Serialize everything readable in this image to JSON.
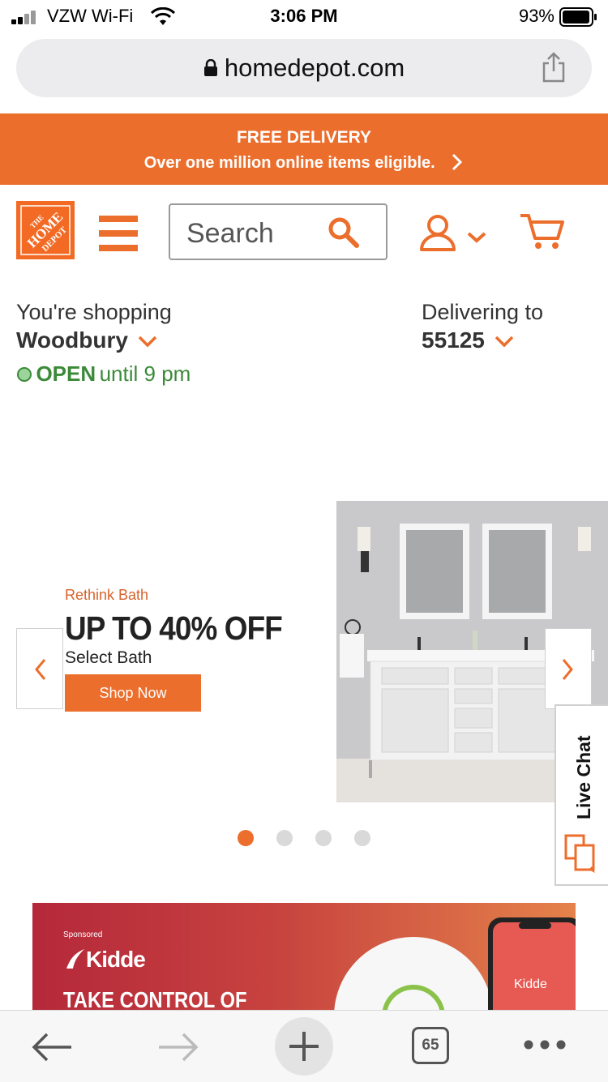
{
  "status": {
    "carrier": "VZW Wi-Fi",
    "time": "3:06 PM",
    "battery": "93%"
  },
  "browser": {
    "url": "homedepot.com",
    "tabs_count": "65"
  },
  "promo": {
    "title": "FREE DELIVERY",
    "subtitle": "Over one million online items eligible."
  },
  "header": {
    "search_placeholder": "Search"
  },
  "store": {
    "shopping_label": "You're shopping",
    "store_name": "Woodbury",
    "status": "OPEN",
    "hours": "until 9 pm",
    "delivering_label": "Delivering to",
    "zip": "55125"
  },
  "hero": {
    "kicker": "Rethink Bath",
    "headline": "UP TO 40% OFF",
    "sub": "Select Bath",
    "cta": "Shop Now",
    "active_slide": 1,
    "slides": 4
  },
  "live_chat": {
    "label": "Live Chat"
  },
  "ad": {
    "sponsored": "Sponsored",
    "brand": "Kidde",
    "headline": "TAKE CONTROL OF",
    "phone_brand": "Kidde"
  },
  "colors": {
    "accent": "#ec6e2c",
    "open_green": "#3b8a38",
    "ad_red": "#b5283a"
  }
}
